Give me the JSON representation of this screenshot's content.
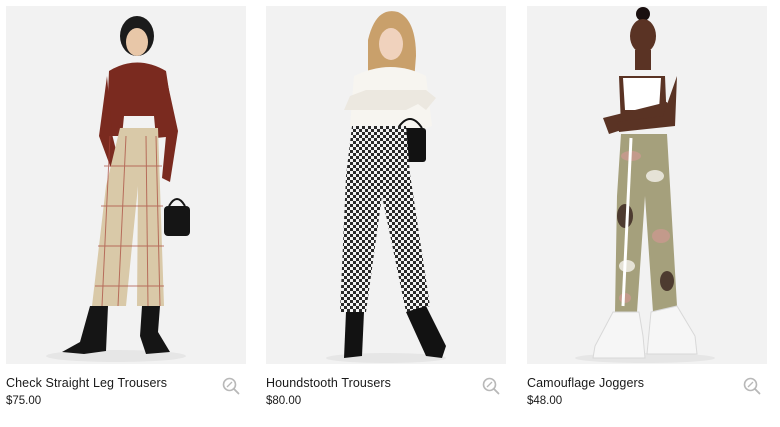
{
  "products": [
    {
      "name": "Check Straight Leg Trousers",
      "price": "$75.00",
      "image_icon": "model-photo-check-trousers"
    },
    {
      "name": "Houndstooth Trousers",
      "price": "$80.00",
      "image_icon": "model-photo-houndstooth-trousers"
    },
    {
      "name": "Camouflage Joggers",
      "price": "$48.00",
      "image_icon": "model-photo-camouflage-joggers"
    }
  ],
  "colors": {
    "tile_bg": "#f2f2f2",
    "text": "#1a1a1a",
    "icon": "#b8b8b8"
  }
}
